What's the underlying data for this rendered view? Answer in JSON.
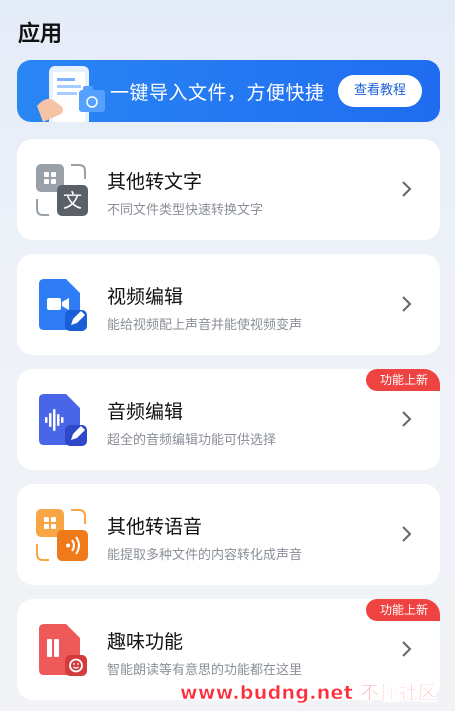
{
  "header": {
    "title": "应用"
  },
  "banner": {
    "text": "一键导入文件，方便快捷",
    "button_label": "查看教程"
  },
  "cards": [
    {
      "name": "其他转文字",
      "desc": "不同文件类型快速转换文字",
      "badge": "",
      "icon": "file-to-text-icon"
    },
    {
      "name": "视频编辑",
      "desc": "能给视频配上声音并能使视频变声",
      "badge": "",
      "icon": "video-edit-icon"
    },
    {
      "name": "音频编辑",
      "desc": "超全的音频编辑功能可供选择",
      "badge": "功能上新",
      "icon": "audio-edit-icon"
    },
    {
      "name": "其他转语音",
      "desc": "能提取多种文件的内容转化成声音",
      "badge": "",
      "icon": "file-to-speech-icon"
    },
    {
      "name": "趣味功能",
      "desc": "智能朗读等有意思的功能都在这里",
      "badge": "功能上新",
      "icon": "fun-features-icon"
    }
  ],
  "watermark": "www.budng.net 不懂社区"
}
